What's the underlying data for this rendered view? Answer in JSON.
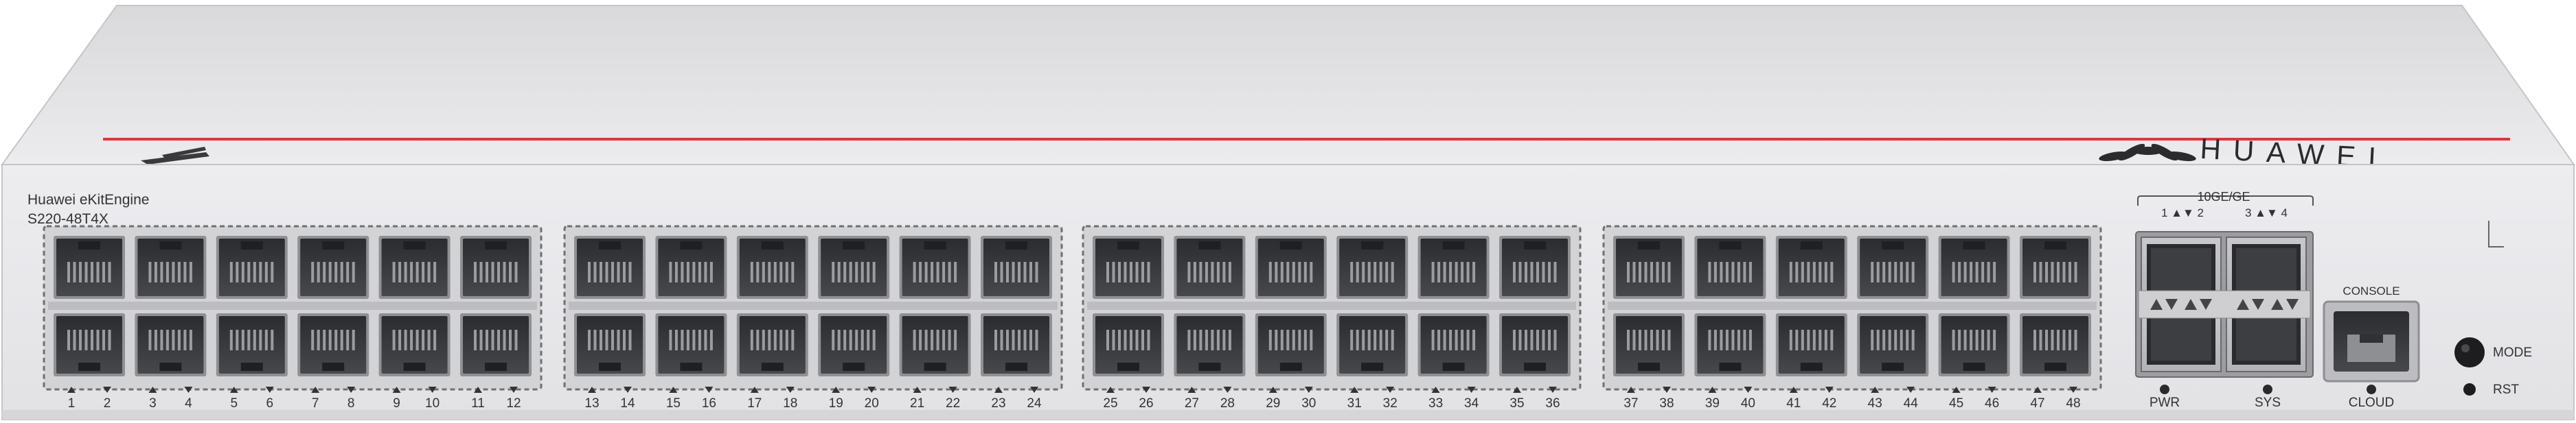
{
  "device": {
    "product_line": "Huawei eKitEngine",
    "model": "S220-48T4X",
    "brand": "HUAWEI"
  },
  "ports": {
    "count": 48,
    "numbers": [
      "1",
      "2",
      "3",
      "4",
      "5",
      "6",
      "7",
      "8",
      "9",
      "10",
      "11",
      "12",
      "13",
      "14",
      "15",
      "16",
      "17",
      "18",
      "19",
      "20",
      "21",
      "22",
      "23",
      "24",
      "25",
      "26",
      "27",
      "28",
      "29",
      "30",
      "31",
      "32",
      "33",
      "34",
      "35",
      "36",
      "37",
      "38",
      "39",
      "40",
      "41",
      "42",
      "43",
      "44",
      "45",
      "46",
      "47",
      "48"
    ]
  },
  "sfp": {
    "title": "10GE/GE",
    "left_pair": "1 ▲▼ 2",
    "right_pair": "3 ▲▼ 4"
  },
  "indicators": {
    "pwr": "PWR",
    "sys": "SYS"
  },
  "console": {
    "label": "CONSOLE",
    "cloud": "CLOUD"
  },
  "buttons": {
    "mode": "MODE",
    "rst": "RST"
  },
  "colors": {
    "chassis": "#e6e6e8",
    "top_cover": "#e0e0e2",
    "accent_stripe": "#d83a3a",
    "port_dark": "#35373a"
  }
}
